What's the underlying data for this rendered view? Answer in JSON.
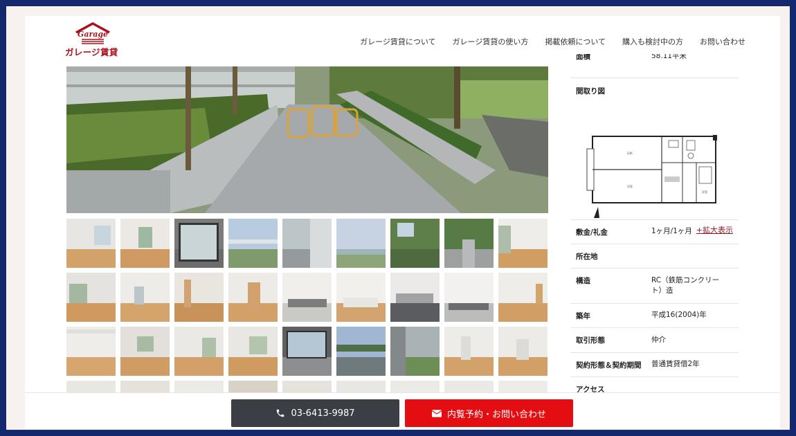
{
  "brand": {
    "logo_script": "Garage",
    "logo_text": "ガレージ賃貸"
  },
  "nav": [
    {
      "label": "ガレージ賃貸について"
    },
    {
      "label": "ガレージ賃貸の使い方"
    },
    {
      "label": "掲載依頼について"
    },
    {
      "label": "購入も検討中の方"
    },
    {
      "label": "お問い合わせ"
    }
  ],
  "details": {
    "area": {
      "key": "面積",
      "value": "58.11平米"
    },
    "floorplan": {
      "key": "間取り図",
      "enlarge": "+拡大表示"
    },
    "deposit": {
      "key": "敷金/礼金",
      "value": "1ヶ月/1ヶ月"
    },
    "location": {
      "key": "所在地",
      "value": ""
    },
    "structure": {
      "key": "構造",
      "value": "RC（鉄筋コンクリート）造"
    },
    "built": {
      "key": "築年",
      "value": "平成16(2004)年"
    },
    "transaction": {
      "key": "取引形態",
      "value": "仲介"
    },
    "contract": {
      "key": "契約形態＆契約期間",
      "value": "普通賃貸借2年"
    },
    "access": {
      "key": "アクセス",
      "value": ""
    }
  },
  "footer": {
    "phone": "03-6413-9987",
    "contact": "内覧予約・お問い合わせ"
  },
  "colors": {
    "brand": "#a8121e",
    "contact_button": "#e40d12",
    "phone_button": "#3b3f45",
    "outer_border": "#14286e"
  }
}
